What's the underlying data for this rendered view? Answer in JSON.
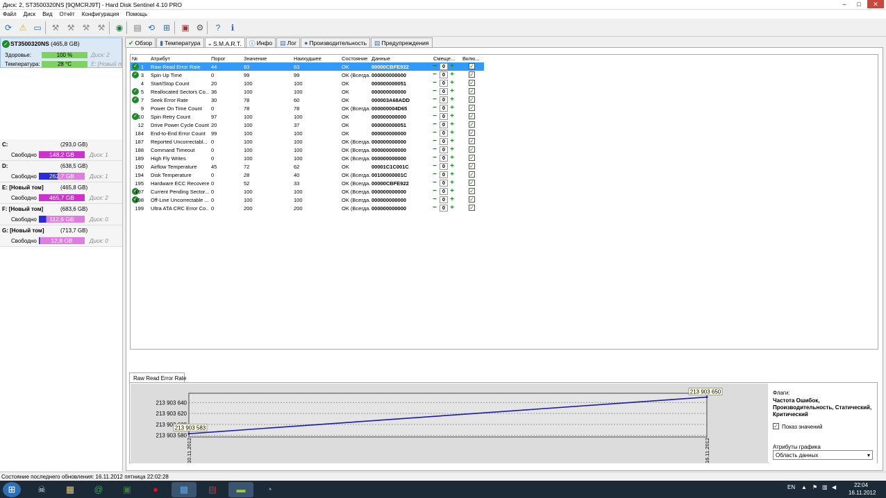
{
  "window": {
    "title": "Диск: 2, ST3500320NS [9QMCRJ9T]  -  Hard Disk Sentinel 4.10 PRO",
    "minimize_icon": "minimize-icon",
    "maximize_icon": "maximize-icon",
    "close_icon": "close-icon"
  },
  "menu": [
    "Файл",
    "Диск",
    "Вид",
    "Отчёт",
    "Конфигурация",
    "Помощь"
  ],
  "toolbar": {
    "icons": [
      "refresh-icon",
      "alert-icon",
      "disk-info-icon",
      "tool1-icon",
      "tool2-icon",
      "tool3-icon",
      "tool4-icon",
      "web-icon",
      "report-icon",
      "update-icon",
      "network-icon",
      "test-icon",
      "settings-icon",
      "help-icon",
      "about-icon"
    ]
  },
  "disk": {
    "name": "ST3500320NS",
    "size": "(465,8 GB)",
    "health_label": "Здоровье:",
    "health": "100 %",
    "health_disk": "Диск: 2",
    "health_fraction": 1.0,
    "temp_label": "Температура:",
    "temp": "28 °C",
    "temp_disk": "E: [Новый том]"
  },
  "volumes": [
    {
      "name": "C:",
      "size": "(293,0 GB)",
      "free_label": "Свободно",
      "free": "148,2 GB",
      "disk": "Диск: 1",
      "color": "#cc33cc",
      "used_fraction": 0.49
    },
    {
      "name": "D:",
      "size": "(638,5 GB)",
      "free_label": "Свободно",
      "free": "262,7 GB",
      "disk": "Диск: 1",
      "color": "#2a2ad9",
      "used_fraction": 0.59
    },
    {
      "name": "E: [Новый том]",
      "size": "(465,8 GB)",
      "free_label": "Свободно",
      "free": "465,7 GB",
      "disk": "Диск: 2",
      "color": "#cc33cc",
      "used_fraction": 0.0
    },
    {
      "name": "F: [Новый том]",
      "size": "(683,6 GB)",
      "free_label": "Свободно",
      "free": "112,6 GB",
      "disk": "Диск: 0",
      "color": "#2a2ad9",
      "used_fraction": 0.84
    },
    {
      "name": "G: [Новый том]",
      "size": "(713,7 GB)",
      "free_label": "Свободно",
      "free": "12,8 GB",
      "disk": "Диск: 0",
      "color": "#2a2ad9",
      "used_fraction": 0.98
    }
  ],
  "tabs": [
    {
      "label": "Обзор",
      "icon": "check-icon"
    },
    {
      "label": "Температура",
      "icon": "thermometer-icon"
    },
    {
      "label": "S.M.A.R.T.",
      "icon": "smart-icon"
    },
    {
      "label": "Инфо",
      "icon": "info-icon"
    },
    {
      "label": "Лог",
      "icon": "log-icon"
    },
    {
      "label": "Производительность",
      "icon": "performance-icon"
    },
    {
      "label": "Предупреждения",
      "icon": "warning-icon"
    }
  ],
  "columns": [
    "№",
    "Атрибут",
    "Порог",
    "Значение",
    "Наихудшее",
    "Состояние",
    "Данные",
    "Смеще...",
    "Вклю..."
  ],
  "rows": [
    {
      "ok": true,
      "num": "1",
      "attr": "Raw Read Error Rate",
      "thr": "44",
      "val": "83",
      "worst": "63",
      "state": "OK",
      "data": "00000CBFE922",
      "offset": "0",
      "sel": true
    },
    {
      "ok": true,
      "num": "3",
      "attr": "Spin Up Time",
      "thr": "0",
      "val": "99",
      "worst": "99",
      "state": "OK (Всегда...",
      "data": "000000000000",
      "offset": "0"
    },
    {
      "ok": false,
      "num": "4",
      "attr": "Start/Stop Count",
      "thr": "20",
      "val": "100",
      "worst": "100",
      "state": "OK",
      "data": "000000000051",
      "offset": "0"
    },
    {
      "ok": true,
      "num": "5",
      "attr": "Reallocated Sectors Co...",
      "thr": "36",
      "val": "100",
      "worst": "100",
      "state": "OK",
      "data": "000000000000",
      "offset": "0"
    },
    {
      "ok": true,
      "num": "7",
      "attr": "Seek Error Rate",
      "thr": "30",
      "val": "78",
      "worst": "60",
      "state": "OK",
      "data": "000003A68ADD",
      "offset": "0"
    },
    {
      "ok": false,
      "num": "9",
      "attr": "Power On Time Count",
      "thr": "0",
      "val": "78",
      "worst": "78",
      "state": "OK (Всегда...",
      "data": "000000004D65",
      "offset": "0"
    },
    {
      "ok": true,
      "num": "10",
      "attr": "Spin Retry Count",
      "thr": "97",
      "val": "100",
      "worst": "100",
      "state": "OK",
      "data": "000000000000",
      "offset": "0"
    },
    {
      "ok": false,
      "num": "12",
      "attr": "Drive Power Cycle Count",
      "thr": "20",
      "val": "100",
      "worst": "37",
      "state": "OK",
      "data": "000000000051",
      "offset": "0"
    },
    {
      "ok": false,
      "num": "184",
      "attr": "End-to-End Error Count",
      "thr": "99",
      "val": "100",
      "worst": "100",
      "state": "OK",
      "data": "000000000000",
      "offset": "0"
    },
    {
      "ok": false,
      "num": "187",
      "attr": "Reported Uncorrectabl...",
      "thr": "0",
      "val": "100",
      "worst": "100",
      "state": "OK (Всегда...",
      "data": "000000000000",
      "offset": "0"
    },
    {
      "ok": false,
      "num": "188",
      "attr": "Command Timeout",
      "thr": "0",
      "val": "100",
      "worst": "100",
      "state": "OK (Всегда...",
      "data": "000000000000",
      "offset": "0"
    },
    {
      "ok": false,
      "num": "189",
      "attr": "High Fly Writes",
      "thr": "0",
      "val": "100",
      "worst": "100",
      "state": "OK (Всегда...",
      "data": "000000000000",
      "offset": "0"
    },
    {
      "ok": false,
      "num": "190",
      "attr": "Airflow Temperature",
      "thr": "45",
      "val": "72",
      "worst": "62",
      "state": "OK",
      "data": "00001C1C001C",
      "offset": "0"
    },
    {
      "ok": false,
      "num": "194",
      "attr": "Disk Temperature",
      "thr": "0",
      "val": "28",
      "worst": "40",
      "state": "OK (Всегда...",
      "data": "00100000001C",
      "offset": "0"
    },
    {
      "ok": false,
      "num": "195",
      "attr": "Hardware ECC Recovered",
      "thr": "0",
      "val": "52",
      "worst": "33",
      "state": "OK (Всегда...",
      "data": "00000CBFE922",
      "offset": "0"
    },
    {
      "ok": true,
      "num": "197",
      "attr": "Current Pending Sector...",
      "thr": "0",
      "val": "100",
      "worst": "100",
      "state": "OK (Всегда...",
      "data": "000000000000",
      "offset": "0"
    },
    {
      "ok": true,
      "num": "198",
      "attr": "Off-Line Uncorrectable ...",
      "thr": "0",
      "val": "100",
      "worst": "100",
      "state": "OK (Всегда...",
      "data": "000000000000",
      "offset": "0"
    },
    {
      "ok": false,
      "num": "199",
      "attr": "Ultra ATA CRC Error Co...",
      "thr": "0",
      "val": "200",
      "worst": "200",
      "state": "OK (Всегда...",
      "data": "000000000000",
      "offset": "0"
    }
  ],
  "chart_tab": "Raw Read Error Rate",
  "chart_data": {
    "type": "line",
    "title": "",
    "xlabel": "",
    "ylabel": "",
    "x": [
      "10.11.2012",
      "16.11.2012"
    ],
    "series": [
      {
        "values": [
          213903583,
          213903650
        ]
      }
    ],
    "y_ticks": [
      "213 903 580",
      "213 903 600",
      "213 903 620",
      "213 903 640"
    ],
    "y_tick_values": [
      213903580,
      213903600,
      213903620,
      213903640
    ],
    "point_labels": [
      "213 903 583",
      "213 903 650"
    ],
    "ylim": [
      213903577,
      213903657
    ],
    "grid": true,
    "line_color": "#1a1aa6"
  },
  "chart_side": {
    "flags_label": "Флаги:",
    "flags": "Частота Ошибок, Производительность, Статический, Критический",
    "show_values": "Показ значений",
    "graph_attr_label": "Атрибуты графика",
    "graph_attr": "Область данных"
  },
  "status": "Состояние последнего обновления: 16.11.2012 пятница 22:02:28",
  "taskbar": {
    "start_icon": "windows-start-icon",
    "apps": [
      "alienware-icon",
      "explorer-icon",
      "qip-icon",
      "app-icon",
      "opera-icon",
      "taskmgr-icon",
      "hdsentinel-icon",
      "printer-icon",
      "mixer-icon"
    ],
    "lang": "EN",
    "time": "22:04",
    "date": "16.11.2012",
    "tray_icons": [
      "tray-chevron-icon",
      "tray-flag-icon",
      "tray-network-icon",
      "tray-volume-icon"
    ]
  }
}
